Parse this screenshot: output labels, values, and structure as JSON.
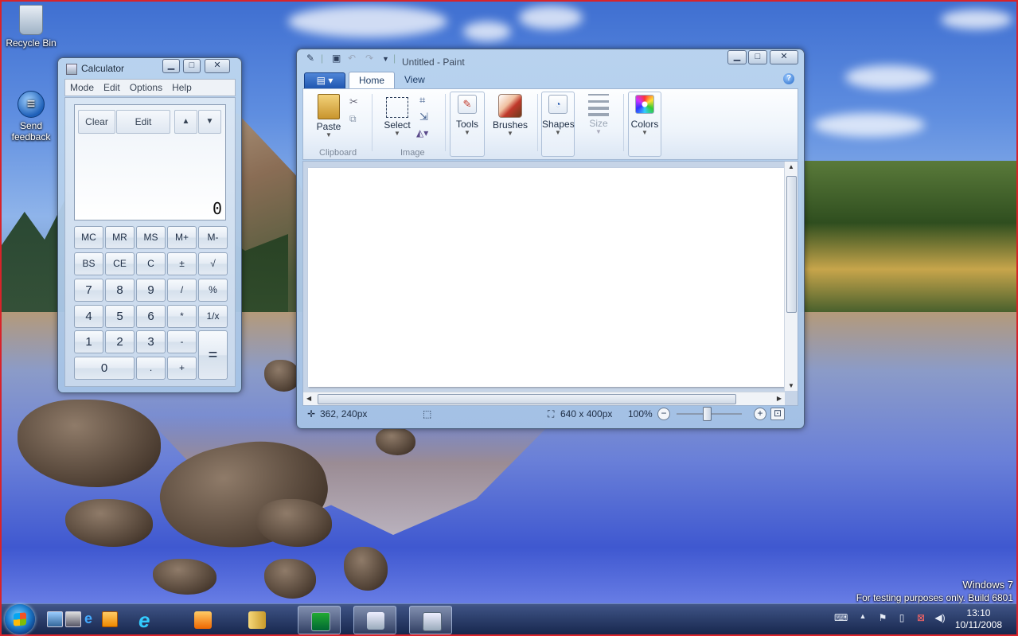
{
  "desktop": {
    "icons": [
      {
        "label": "Recycle Bin"
      },
      {
        "label": "Send feedback"
      }
    ],
    "watermark_line1": "Windows  7",
    "watermark_line2": "For testing purposes only. Build 6801"
  },
  "calculator": {
    "title": "Calculator",
    "menu": [
      "Mode",
      "Edit",
      "Options",
      "Help"
    ],
    "display_buttons": {
      "clear": "Clear",
      "edit": "Edit",
      "up": "▲",
      "down": "▼"
    },
    "display_value": "0",
    "keys": {
      "mc": "MC",
      "mr": "MR",
      "ms": "MS",
      "mplus": "M+",
      "mminus": "M-",
      "bs": "BS",
      "ce": "CE",
      "c": "C",
      "plusminus": "±",
      "sqrt": "√",
      "k7": "7",
      "k8": "8",
      "k9": "9",
      "div": "/",
      "pct": "%",
      "k4": "4",
      "k5": "5",
      "k6": "6",
      "mul": "*",
      "recip": "1/x",
      "k1": "1",
      "k2": "2",
      "k3": "3",
      "sub": "-",
      "eq": "=",
      "k0": "0",
      "dot": ".",
      "add": "+"
    }
  },
  "paint": {
    "title": "Untitled - Paint",
    "tabs": {
      "home": "Home",
      "view": "View"
    },
    "help": "?",
    "ribbon": {
      "paste": "Paste",
      "clipboard_group": "Clipboard",
      "select": "Select",
      "image_group": "Image",
      "tools": "Tools",
      "brushes": "Brushes",
      "shapes": "Shapes",
      "size": "Size",
      "colors": "Colors"
    },
    "status": {
      "cursor_pos": "362, 240px",
      "image_size": "640 x 400px",
      "zoom": "100%"
    }
  },
  "taskbar": {
    "clock_time": "13:10",
    "clock_date": "10/11/2008"
  },
  "colors": {
    "taskbar": "#1c2d55",
    "window_frame": "#b7d0ec",
    "accent": "#1f56b0"
  }
}
